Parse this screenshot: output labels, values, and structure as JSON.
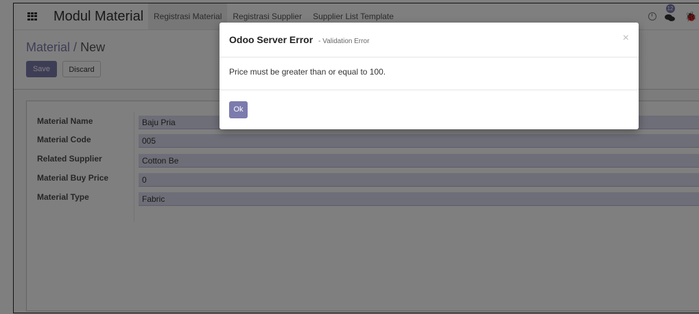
{
  "navbar": {
    "brand": "Modul Material",
    "menu": [
      "Registrasi Material",
      "Registrasi Supplier",
      "Supplier List Template"
    ],
    "message_count": "12"
  },
  "breadcrumb": {
    "parent": "Material",
    "separator": "/",
    "current": "New"
  },
  "buttons": {
    "save": "Save",
    "discard": "Discard"
  },
  "form": {
    "fields": [
      {
        "label": "Material Name",
        "value": "Baju Pria"
      },
      {
        "label": "Material Code",
        "value": "005"
      },
      {
        "label": "Related Supplier",
        "value": "Cotton Be"
      },
      {
        "label": "Material Buy Price",
        "value": "0"
      },
      {
        "label": "Material Type",
        "value": "Fabric"
      }
    ]
  },
  "dialog": {
    "title": "Odoo Server Error",
    "subtitle": "- Validation Error",
    "close": "×",
    "message": "Price must be greater than or equal to 100.",
    "ok": "Ok"
  },
  "colors": {
    "accent": "#7c7bad",
    "field_bg": "#dcdcf0",
    "overlay": "rgba(0,0,0,0.5)"
  }
}
